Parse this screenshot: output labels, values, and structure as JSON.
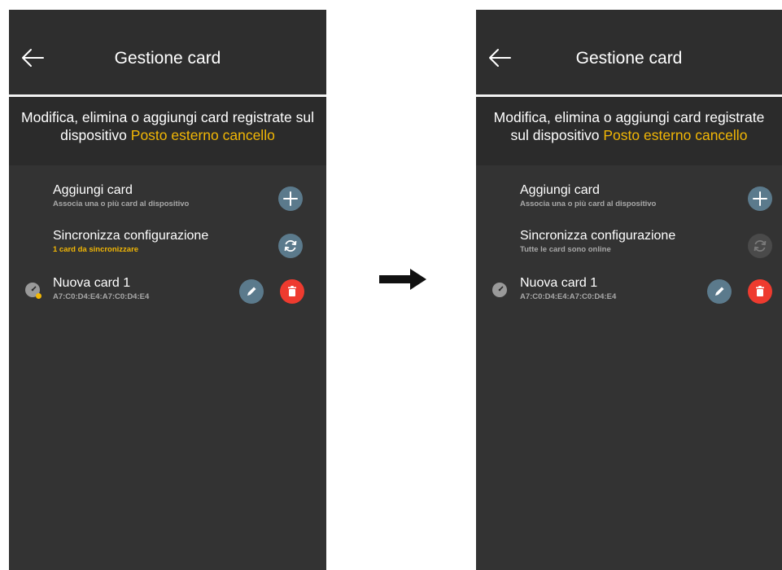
{
  "screens": [
    {
      "header": {
        "title": "Gestione card"
      },
      "intro": {
        "text": "Modifica, elimina o aggiungi card registrate sul dispositivo",
        "device_name": "Posto esterno cancello"
      },
      "items": {
        "add": {
          "title": "Aggiungi card",
          "subtitle": "Associa una o più card al dispositivo"
        },
        "sync": {
          "title": "Sincronizza configurazione",
          "subtitle": "1 card da sincronizzare",
          "enabled": true
        },
        "card": {
          "name": "Nuova card 1",
          "code": "A7:C0:D4:E4:A7:C0:D4:E4",
          "pending_sync": true
        }
      }
    },
    {
      "header": {
        "title": "Gestione card"
      },
      "intro": {
        "text": "Modifica, elimina o aggiungi card registrate sul dispositivo",
        "device_name": "Posto esterno cancello"
      },
      "items": {
        "add": {
          "title": "Aggiungi card",
          "subtitle": "Associa una o più card al dispositivo"
        },
        "sync": {
          "title": "Sincronizza configurazione",
          "subtitle": "Tutte le card sono online",
          "enabled": false
        },
        "card": {
          "name": "Nuova card 1",
          "code": "A7:C0:D4:E4:A7:C0:D4:E4",
          "pending_sync": false
        }
      }
    }
  ],
  "icons": {
    "back": "arrow-left-icon",
    "add": "plus-icon",
    "sync": "refresh-icon",
    "card": "card-reader-icon",
    "edit": "pencil-icon",
    "delete": "trash-icon",
    "transition": "right-arrow-icon"
  },
  "colors": {
    "screen_bg": "#2e2e2e",
    "accent_yellow": "#f2b705",
    "button_blue": "#5b7a8c",
    "button_red": "#ee3b2f",
    "button_disabled": "#4a4a4a"
  }
}
